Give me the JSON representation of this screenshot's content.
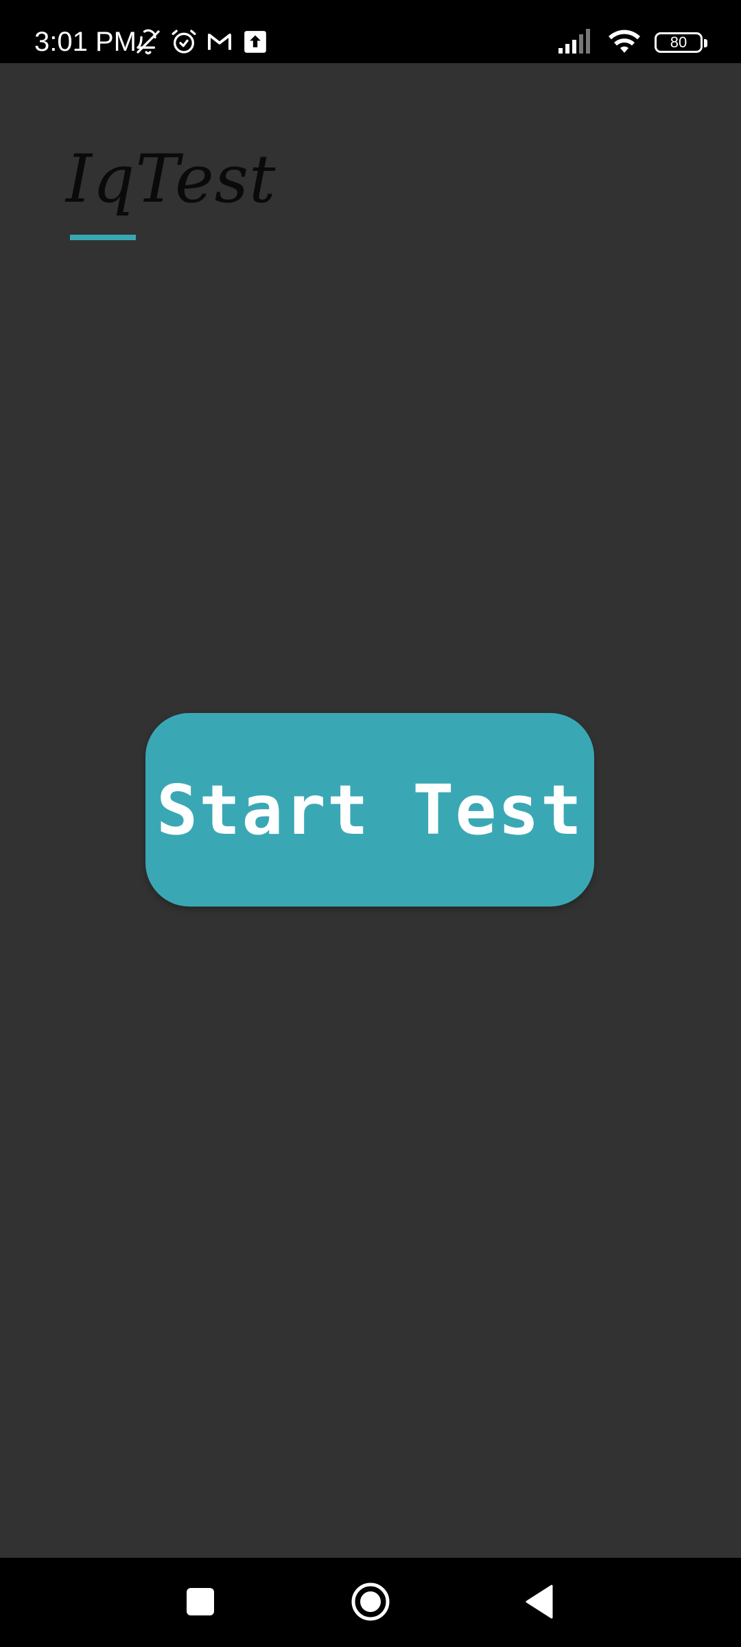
{
  "status_bar": {
    "time": "3:01 PM",
    "battery_level": "80",
    "left_icons": [
      "bell-off-icon",
      "alarm-icon",
      "gmail-icon",
      "upload-icon"
    ],
    "right_icons": [
      "signal-icon",
      "wifi-icon",
      "battery-icon"
    ]
  },
  "app": {
    "title": "IqTest",
    "accent_color": "#3aa8b4",
    "background_color": "#323232"
  },
  "main": {
    "start_button_label": "Start Test"
  },
  "nav_bar": {
    "buttons": [
      "recents-icon",
      "home-icon",
      "back-icon"
    ]
  }
}
